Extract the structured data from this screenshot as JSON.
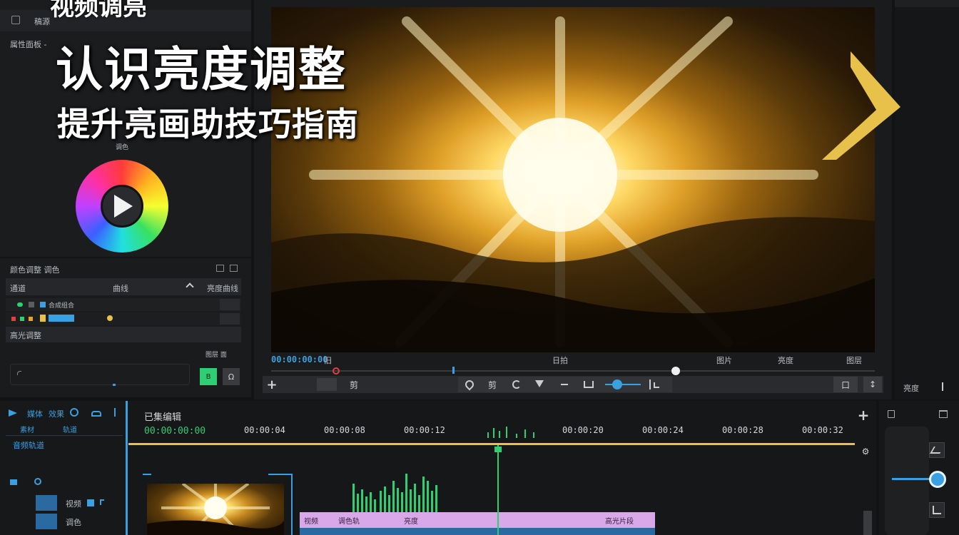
{
  "overlay": {
    "top_text": "视频调亮",
    "title": "认识亮度调整",
    "subtitle": "提升亮画助技巧指南"
  },
  "left_panel": {
    "header_label": "稿源",
    "section_label": "属性面板 -",
    "wheel_caption": "调色",
    "list_title": "颜色调整 调色",
    "col_a": "通道",
    "col_b": "曲线",
    "col_c": "亮度曲线",
    "row1_text": "合成组合",
    "row3_label": "高光调整",
    "small_label": "图层 面",
    "green_btn": "B",
    "grey_btn": "Ω"
  },
  "preview": {
    "timecode": "00:00:00:00",
    "mark_a": "旧",
    "center_label": "日拍",
    "right_a": "图片",
    "right_b": "亮度",
    "right_c": "图层",
    "playhead_percent": 67,
    "volume_percent": 20
  },
  "toolbar": {
    "add": "+",
    "crop": "剪",
    "cut": "剪",
    "right_icon": "口",
    "right_icon2": "↕"
  },
  "right_panel": {
    "chevron": ">",
    "bottom_label": "亮度",
    "slider_value_percent": 62
  },
  "timeline": {
    "title": "已集编辑",
    "timecode": "00:00:00:00",
    "ticks": [
      "00:00:04",
      "00:00:08",
      "00:00:12",
      "00:00:20",
      "00:00:24",
      "00:00:28",
      "00:00:32"
    ],
    "clip_label_a": "视频",
    "clip_label_b": "调色轨",
    "clip_label_c": "亮度",
    "clip_label_d": "高光片段",
    "add": "+",
    "settings": "⚙"
  },
  "tracks": {
    "header_a": "媒体",
    "header_b": "效果",
    "sub_a": "素材",
    "sub_b": "轨道",
    "list_label": "音频轨道",
    "track_v1": "视频",
    "track_v2": "调色"
  },
  "colors": {
    "accent_yellow": "#e8c14a",
    "accent_green": "#2ecf72",
    "clip_purple": "#d8a8e8",
    "accent_blue": "#3aa0e0"
  }
}
